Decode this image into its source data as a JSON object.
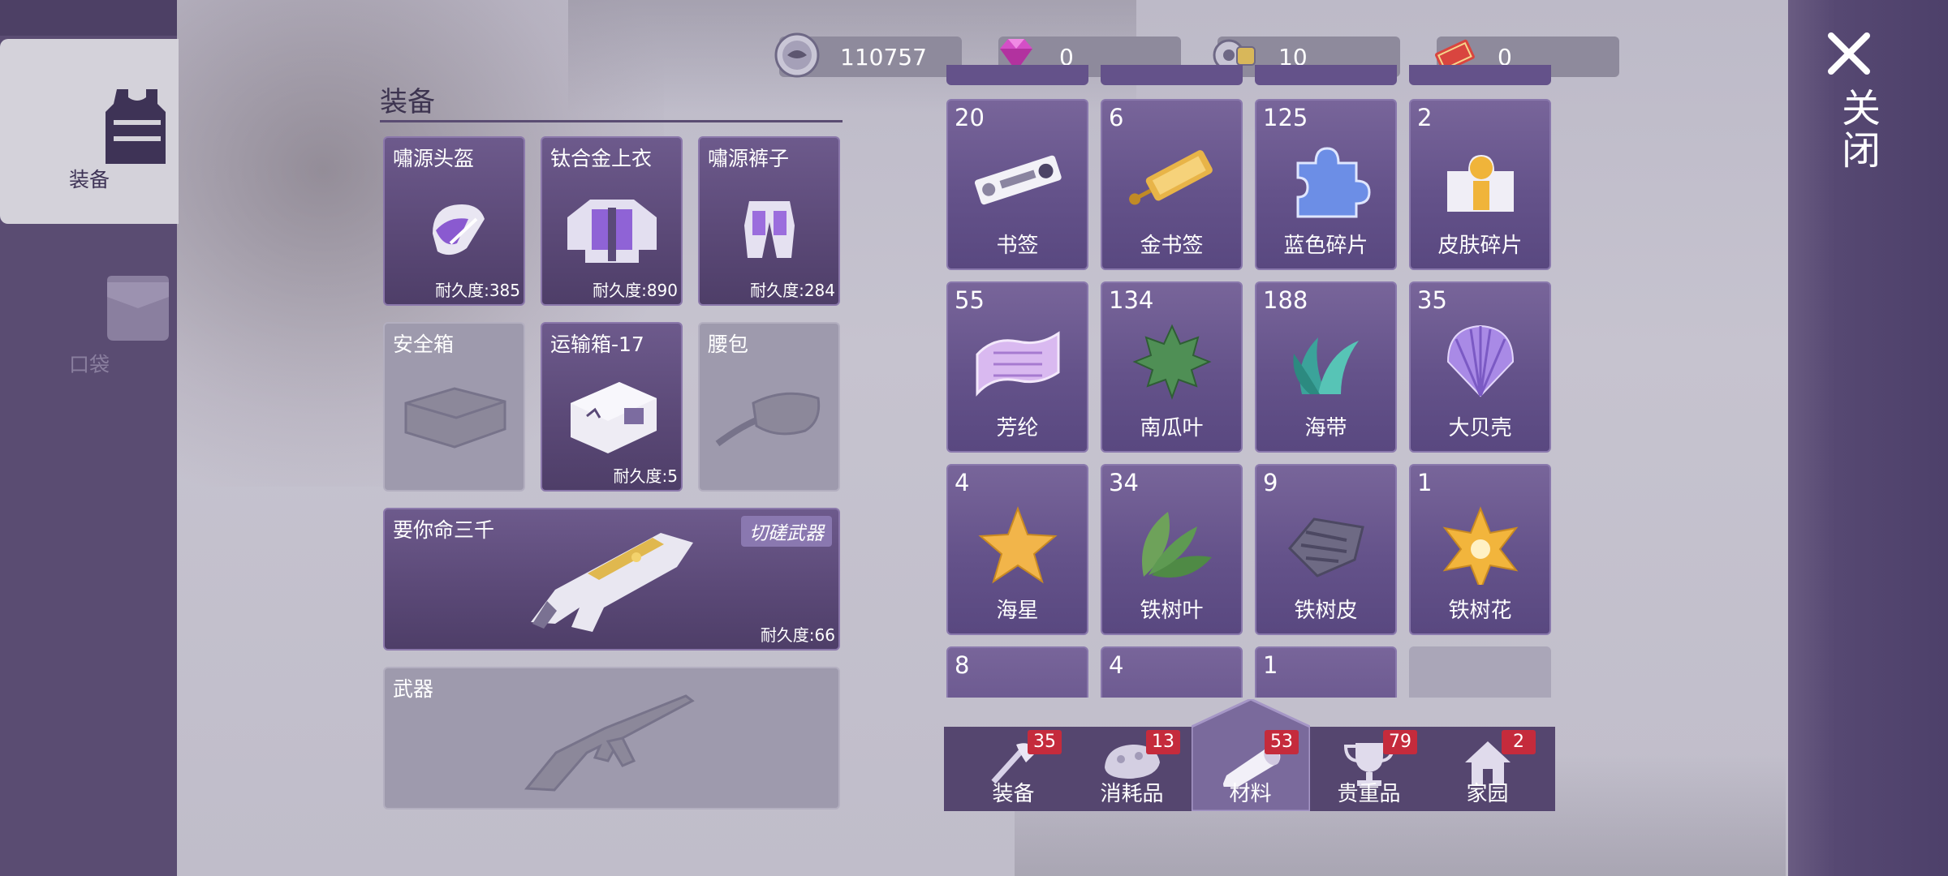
{
  "sidebar": {
    "tabs": [
      {
        "label": "装备",
        "icon": "vest-icon",
        "active": true
      },
      {
        "label": "口袋",
        "icon": "pocket-icon",
        "active": false
      }
    ]
  },
  "close": {
    "label": "关闭",
    "icon": "close-icon"
  },
  "currencies": [
    {
      "icon": "silver-coin-icon",
      "value": "110757"
    },
    {
      "icon": "diamond-icon",
      "value": "0"
    },
    {
      "icon": "gear-token-icon",
      "value": "10"
    },
    {
      "icon": "ticket-icon",
      "value": "0"
    }
  ],
  "equipment": {
    "title": "装备",
    "slots": [
      {
        "name": "嘯源头盔",
        "durability": "耐久度:385",
        "icon": "helmet-icon",
        "filled": true
      },
      {
        "name": "钛合金上衣",
        "durability": "耐久度:890",
        "icon": "armor-vest-icon",
        "filled": true
      },
      {
        "name": "嘯源裤子",
        "durability": "耐久度:284",
        "icon": "pants-icon",
        "filled": true
      },
      {
        "name": "安全箱",
        "durability": "",
        "icon": "briefcase-icon",
        "filled": false
      },
      {
        "name": "运输箱-17",
        "durability": "耐久度:5",
        "icon": "transport-box-icon",
        "filled": true
      },
      {
        "name": "腰包",
        "durability": "",
        "icon": "waist-bag-icon",
        "filled": false
      }
    ],
    "weapon_main": {
      "name": "要你命三千",
      "tag": "切磋武器",
      "durability": "耐久度:66",
      "icon": "blaster-gun-icon"
    },
    "weapon_slot": {
      "name": "武器",
      "icon": "rifle-icon"
    }
  },
  "materials": [
    {
      "count": "20",
      "name": "书签",
      "icon": "bookmark-icon"
    },
    {
      "count": "6",
      "name": "金书签",
      "icon": "gold-bookmark-icon"
    },
    {
      "count": "125",
      "name": "蓝色碎片",
      "icon": "blue-puzzle-icon"
    },
    {
      "count": "2",
      "name": "皮肤碎片",
      "icon": "skin-fragment-icon"
    },
    {
      "count": "55",
      "name": "芳纶",
      "icon": "fabric-icon"
    },
    {
      "count": "134",
      "name": "南瓜叶",
      "icon": "leaf-icon"
    },
    {
      "count": "188",
      "name": "海带",
      "icon": "kelp-icon"
    },
    {
      "count": "35",
      "name": "大贝壳",
      "icon": "shell-icon"
    },
    {
      "count": "4",
      "name": "海星",
      "icon": "starfish-icon"
    },
    {
      "count": "34",
      "name": "铁树叶",
      "icon": "iron-leaf-icon"
    },
    {
      "count": "9",
      "name": "铁树皮",
      "icon": "bark-icon"
    },
    {
      "count": "1",
      "name": "铁树花",
      "icon": "flower-icon"
    },
    {
      "count": "8",
      "name": "",
      "icon": "item-icon"
    },
    {
      "count": "4",
      "name": "",
      "icon": "item-icon"
    },
    {
      "count": "1",
      "name": "",
      "icon": "item-icon"
    }
  ],
  "bottom_tabs": [
    {
      "label": "装备",
      "badge": "35",
      "icon": "axe-icon",
      "active": false
    },
    {
      "label": "消耗品",
      "badge": "13",
      "icon": "food-icon",
      "active": false
    },
    {
      "label": "材料",
      "badge": "53",
      "icon": "log-icon",
      "active": true
    },
    {
      "label": "贵重品",
      "badge": "79",
      "icon": "trophy-icon",
      "active": false
    },
    {
      "label": "家园",
      "badge": "2",
      "icon": "home-icon",
      "active": false
    }
  ],
  "colors": {
    "panel": "#5a4c72",
    "card": "#64528a",
    "badge": "#c52b3c",
    "accent": "#8a78b0"
  }
}
